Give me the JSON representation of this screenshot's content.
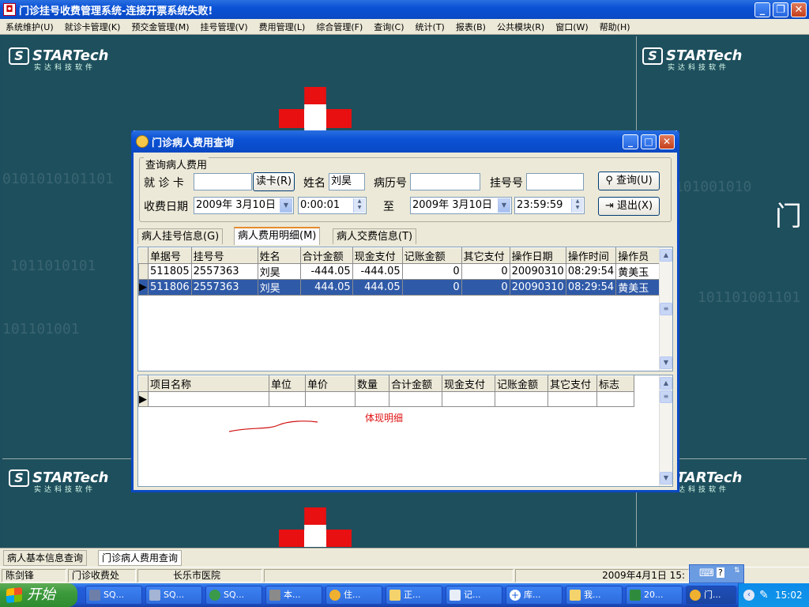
{
  "app": {
    "title": "门诊挂号收费管理系统-连接开票系统失败!"
  },
  "menu": [
    "系统维护(U)",
    "就诊卡管理(K)",
    "预交金管理(M)",
    "挂号管理(V)",
    "费用管理(L)",
    "综合管理(F)",
    "查询(C)",
    "统计(T)",
    "报表(B)",
    "公共模块(R)",
    "窗口(W)",
    "帮助(H)"
  ],
  "desktop": {
    "logo_text": "STARTech",
    "logo_sub": "实达科技软件",
    "side_text": "门"
  },
  "dialog": {
    "title": "门诊病人费用查询",
    "group_label": "查询病人费用",
    "card_label": "就 诊 卡",
    "card_value": "",
    "read_card_button": "读卡(R)",
    "name_label": "姓名",
    "name_value": "刘昊",
    "record_label": "病历号",
    "record_value": "",
    "reg_label": "挂号号",
    "reg_value": "",
    "query_button": "查询(U)",
    "date_label": "收费日期",
    "date_from": "2009年 3月10日",
    "time_from": "0:00:01",
    "to_label": "至",
    "date_to": "2009年 3月10日",
    "time_to": "23:59:59",
    "exit_button": "退出(X)",
    "tabs": [
      "病人挂号信息(G)",
      "病人费用明细(M)",
      "病人交费信息(T)"
    ],
    "upper_grid": {
      "columns": [
        "单据号",
        "挂号号",
        "姓名",
        "合计金额",
        "现金支付",
        "记账金额",
        "其它支付",
        "操作日期",
        "操作时间",
        "操作员"
      ],
      "rows": [
        [
          "511805",
          "2557363",
          "刘昊",
          "-444.05",
          "-444.05",
          "0",
          "0",
          "20090310",
          "08:29:54",
          "黄美玉"
        ],
        [
          "511806",
          "2557363",
          "刘昊",
          "444.05",
          "444.05",
          "0",
          "0",
          "20090310",
          "08:29:54",
          "黄美玉"
        ]
      ],
      "selected_row": 1
    },
    "lower_grid": {
      "columns": [
        "项目名称",
        "单位",
        "单价",
        "数量",
        "合计金额",
        "现金支付",
        "记账金额",
        "其它支付",
        "标志"
      ]
    },
    "annotation": "体现明细"
  },
  "window_tabs": [
    "病人基本信息查询",
    "门诊病人费用查询"
  ],
  "status": {
    "user": "陈剑锋",
    "department": "门诊收费处",
    "hospital": "长乐市医院",
    "datetime": "2009年4月1日 15:"
  },
  "taskbar": {
    "start_label": "开始",
    "items": [
      "SQ...",
      "SQ...",
      "SQ...",
      "本...",
      "住...",
      "正...",
      "记...",
      "库...",
      "我...",
      "20...",
      "门..."
    ],
    "clock": "15:02"
  }
}
